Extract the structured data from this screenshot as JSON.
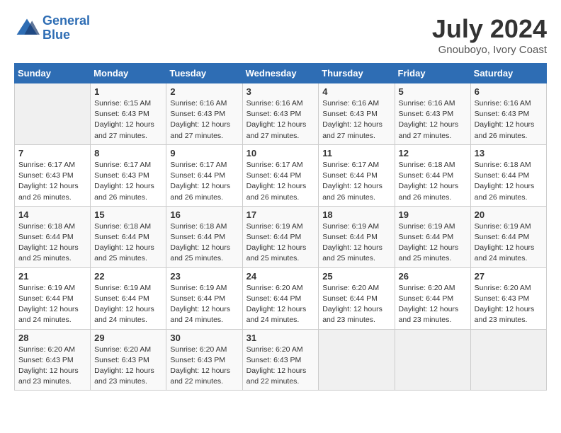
{
  "header": {
    "logo_line1": "General",
    "logo_line2": "Blue",
    "month_year": "July 2024",
    "location": "Gnouboyo, Ivory Coast"
  },
  "days_of_week": [
    "Sunday",
    "Monday",
    "Tuesday",
    "Wednesday",
    "Thursday",
    "Friday",
    "Saturday"
  ],
  "weeks": [
    [
      {
        "day": "",
        "info": ""
      },
      {
        "day": "1",
        "info": "Sunrise: 6:15 AM\nSunset: 6:43 PM\nDaylight: 12 hours\nand 27 minutes."
      },
      {
        "day": "2",
        "info": "Sunrise: 6:16 AM\nSunset: 6:43 PM\nDaylight: 12 hours\nand 27 minutes."
      },
      {
        "day": "3",
        "info": "Sunrise: 6:16 AM\nSunset: 6:43 PM\nDaylight: 12 hours\nand 27 minutes."
      },
      {
        "day": "4",
        "info": "Sunrise: 6:16 AM\nSunset: 6:43 PM\nDaylight: 12 hours\nand 27 minutes."
      },
      {
        "day": "5",
        "info": "Sunrise: 6:16 AM\nSunset: 6:43 PM\nDaylight: 12 hours\nand 27 minutes."
      },
      {
        "day": "6",
        "info": "Sunrise: 6:16 AM\nSunset: 6:43 PM\nDaylight: 12 hours\nand 26 minutes."
      }
    ],
    [
      {
        "day": "7",
        "info": "Sunrise: 6:17 AM\nSunset: 6:43 PM\nDaylight: 12 hours\nand 26 minutes."
      },
      {
        "day": "8",
        "info": "Sunrise: 6:17 AM\nSunset: 6:43 PM\nDaylight: 12 hours\nand 26 minutes."
      },
      {
        "day": "9",
        "info": "Sunrise: 6:17 AM\nSunset: 6:44 PM\nDaylight: 12 hours\nand 26 minutes."
      },
      {
        "day": "10",
        "info": "Sunrise: 6:17 AM\nSunset: 6:44 PM\nDaylight: 12 hours\nand 26 minutes."
      },
      {
        "day": "11",
        "info": "Sunrise: 6:17 AM\nSunset: 6:44 PM\nDaylight: 12 hours\nand 26 minutes."
      },
      {
        "day": "12",
        "info": "Sunrise: 6:18 AM\nSunset: 6:44 PM\nDaylight: 12 hours\nand 26 minutes."
      },
      {
        "day": "13",
        "info": "Sunrise: 6:18 AM\nSunset: 6:44 PM\nDaylight: 12 hours\nand 26 minutes."
      }
    ],
    [
      {
        "day": "14",
        "info": "Sunrise: 6:18 AM\nSunset: 6:44 PM\nDaylight: 12 hours\nand 25 minutes."
      },
      {
        "day": "15",
        "info": "Sunrise: 6:18 AM\nSunset: 6:44 PM\nDaylight: 12 hours\nand 25 minutes."
      },
      {
        "day": "16",
        "info": "Sunrise: 6:18 AM\nSunset: 6:44 PM\nDaylight: 12 hours\nand 25 minutes."
      },
      {
        "day": "17",
        "info": "Sunrise: 6:19 AM\nSunset: 6:44 PM\nDaylight: 12 hours\nand 25 minutes."
      },
      {
        "day": "18",
        "info": "Sunrise: 6:19 AM\nSunset: 6:44 PM\nDaylight: 12 hours\nand 25 minutes."
      },
      {
        "day": "19",
        "info": "Sunrise: 6:19 AM\nSunset: 6:44 PM\nDaylight: 12 hours\nand 25 minutes."
      },
      {
        "day": "20",
        "info": "Sunrise: 6:19 AM\nSunset: 6:44 PM\nDaylight: 12 hours\nand 24 minutes."
      }
    ],
    [
      {
        "day": "21",
        "info": "Sunrise: 6:19 AM\nSunset: 6:44 PM\nDaylight: 12 hours\nand 24 minutes."
      },
      {
        "day": "22",
        "info": "Sunrise: 6:19 AM\nSunset: 6:44 PM\nDaylight: 12 hours\nand 24 minutes."
      },
      {
        "day": "23",
        "info": "Sunrise: 6:19 AM\nSunset: 6:44 PM\nDaylight: 12 hours\nand 24 minutes."
      },
      {
        "day": "24",
        "info": "Sunrise: 6:20 AM\nSunset: 6:44 PM\nDaylight: 12 hours\nand 24 minutes."
      },
      {
        "day": "25",
        "info": "Sunrise: 6:20 AM\nSunset: 6:44 PM\nDaylight: 12 hours\nand 23 minutes."
      },
      {
        "day": "26",
        "info": "Sunrise: 6:20 AM\nSunset: 6:44 PM\nDaylight: 12 hours\nand 23 minutes."
      },
      {
        "day": "27",
        "info": "Sunrise: 6:20 AM\nSunset: 6:43 PM\nDaylight: 12 hours\nand 23 minutes."
      }
    ],
    [
      {
        "day": "28",
        "info": "Sunrise: 6:20 AM\nSunset: 6:43 PM\nDaylight: 12 hours\nand 23 minutes."
      },
      {
        "day": "29",
        "info": "Sunrise: 6:20 AM\nSunset: 6:43 PM\nDaylight: 12 hours\nand 23 minutes."
      },
      {
        "day": "30",
        "info": "Sunrise: 6:20 AM\nSunset: 6:43 PM\nDaylight: 12 hours\nand 22 minutes."
      },
      {
        "day": "31",
        "info": "Sunrise: 6:20 AM\nSunset: 6:43 PM\nDaylight: 12 hours\nand 22 minutes."
      },
      {
        "day": "",
        "info": ""
      },
      {
        "day": "",
        "info": ""
      },
      {
        "day": "",
        "info": ""
      }
    ]
  ]
}
